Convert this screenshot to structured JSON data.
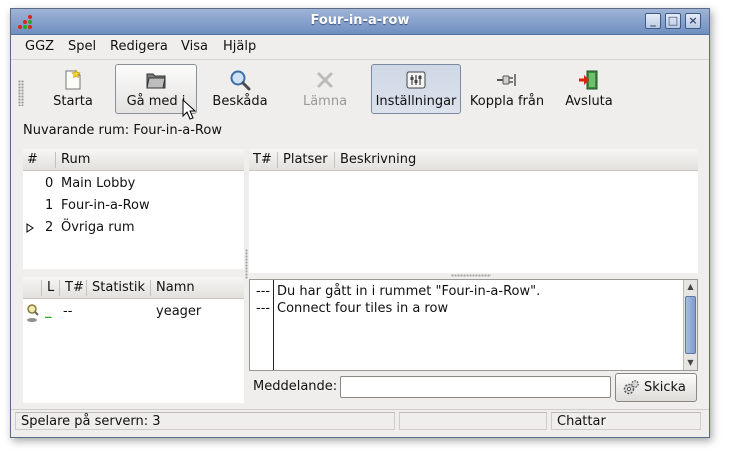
{
  "window": {
    "title": "Four-in-a-row"
  },
  "menu": [
    "GGZ",
    "Spel",
    "Redigera",
    "Visa",
    "Hjälp"
  ],
  "toolbar": {
    "start": "Starta",
    "join": "Gå med i",
    "watch": "Beskåda",
    "leave": "Lämna",
    "settings": "Inställningar",
    "disconnect": "Koppla från",
    "quit": "Avsluta"
  },
  "current_room": "Nuvarande rum: Four-in-a-Row",
  "rooms": {
    "headers": [
      "#",
      "Rum"
    ],
    "rows": [
      {
        "num": "0",
        "name": "Main Lobby"
      },
      {
        "num": "1",
        "name": "Four-in-a-Row"
      },
      {
        "num": "2",
        "name": "Övriga rum"
      }
    ]
  },
  "tables": {
    "headers": [
      "T#",
      "Platser",
      "Beskrivning"
    ]
  },
  "players": {
    "headers": [
      "L",
      "T#",
      "Statistik",
      "Namn"
    ],
    "rows": [
      {
        "lag": "_",
        "table": "--",
        "stats": "",
        "name": "yeager"
      }
    ]
  },
  "chat": {
    "lines": [
      {
        "prefix": "---",
        "text": "Du har gått in i rummet \"Four-in-a-Row\"."
      },
      {
        "prefix": "---",
        "text": "Connect four tiles in a row"
      }
    ]
  },
  "message": {
    "label": "Meddelande:",
    "value": "",
    "send": "Skicka"
  },
  "status": {
    "players": "Spelare på servern: 3",
    "state": "Chattar"
  },
  "colors": {
    "accent": "#6f8fc0",
    "lag_ok": "#22aa22"
  }
}
